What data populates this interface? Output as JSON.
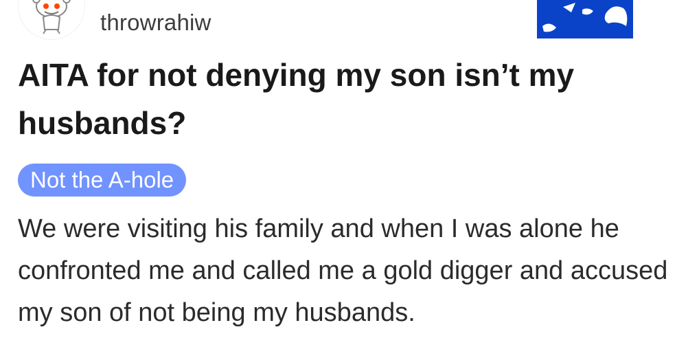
{
  "post": {
    "username": "throwrahiw",
    "title": "AITA for not denying my son isn’t my husbands?",
    "flair": "Not the A-hole",
    "body": "We were visiting his family and when I was alone he confronted me and called me a gold digger and accused my son of not being my husbands."
  },
  "colors": {
    "flair_bg": "#7193ff",
    "badge_blue": "#0a43c8"
  },
  "icons": {
    "avatar": "reddit-snoo-avatar-icon",
    "badge": "award-badge-icon"
  }
}
